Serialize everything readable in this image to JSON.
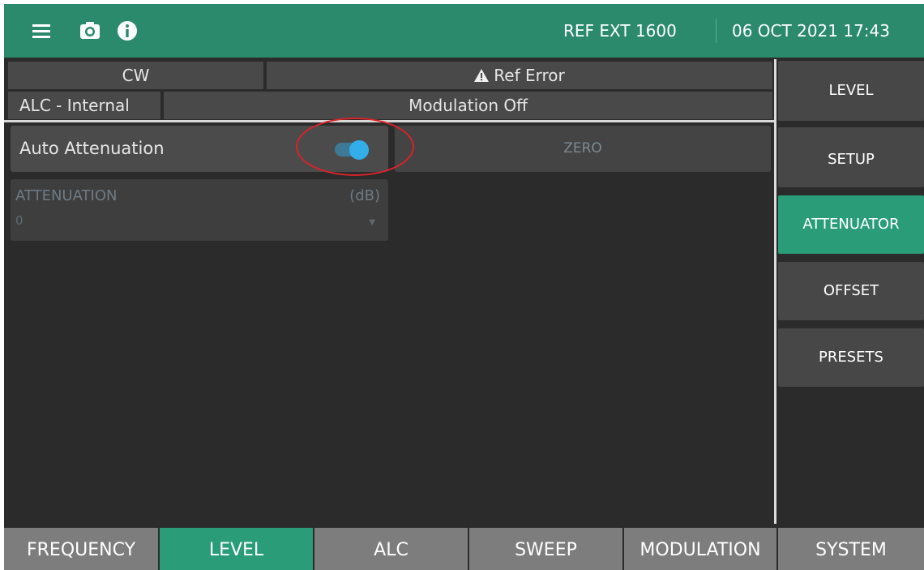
{
  "header": {
    "menu_icon": "hamburger-menu-icon",
    "camera_icon": "camera-icon",
    "info_icon": "info-icon",
    "ref": "REF EXT 1600",
    "datetime": "06 OCT 2021 17:43"
  },
  "status": {
    "mode": "CW",
    "error": "Ref Error",
    "error_icon": "warning-icon",
    "alc": "ALC - Internal",
    "modulation": "Modulation Off"
  },
  "attenuator": {
    "auto_label": "Auto Attenuation",
    "auto_enabled": true,
    "zero_label": "ZERO",
    "field_label": "ATTENUATION",
    "field_unit": "(dB)",
    "field_value": "0"
  },
  "side_menu": [
    {
      "label": "LEVEL",
      "active": false
    },
    {
      "label": "SETUP",
      "active": false
    },
    {
      "label": "ATTENUATOR",
      "active": true
    },
    {
      "label": "OFFSET",
      "active": false
    },
    {
      "label": "PRESETS",
      "active": false
    }
  ],
  "bottom_tabs": [
    {
      "label": "FREQUENCY",
      "active": false
    },
    {
      "label": "LEVEL",
      "active": true
    },
    {
      "label": "ALC",
      "active": false
    },
    {
      "label": "SWEEP",
      "active": false
    },
    {
      "label": "MODULATION",
      "active": false
    },
    {
      "label": "SYSTEM",
      "active": false
    }
  ],
  "colors": {
    "accent": "#2a9d78",
    "topbar": "#2a8a6b",
    "toggle_on": "#34aeea",
    "annotation": "#d8232a"
  }
}
